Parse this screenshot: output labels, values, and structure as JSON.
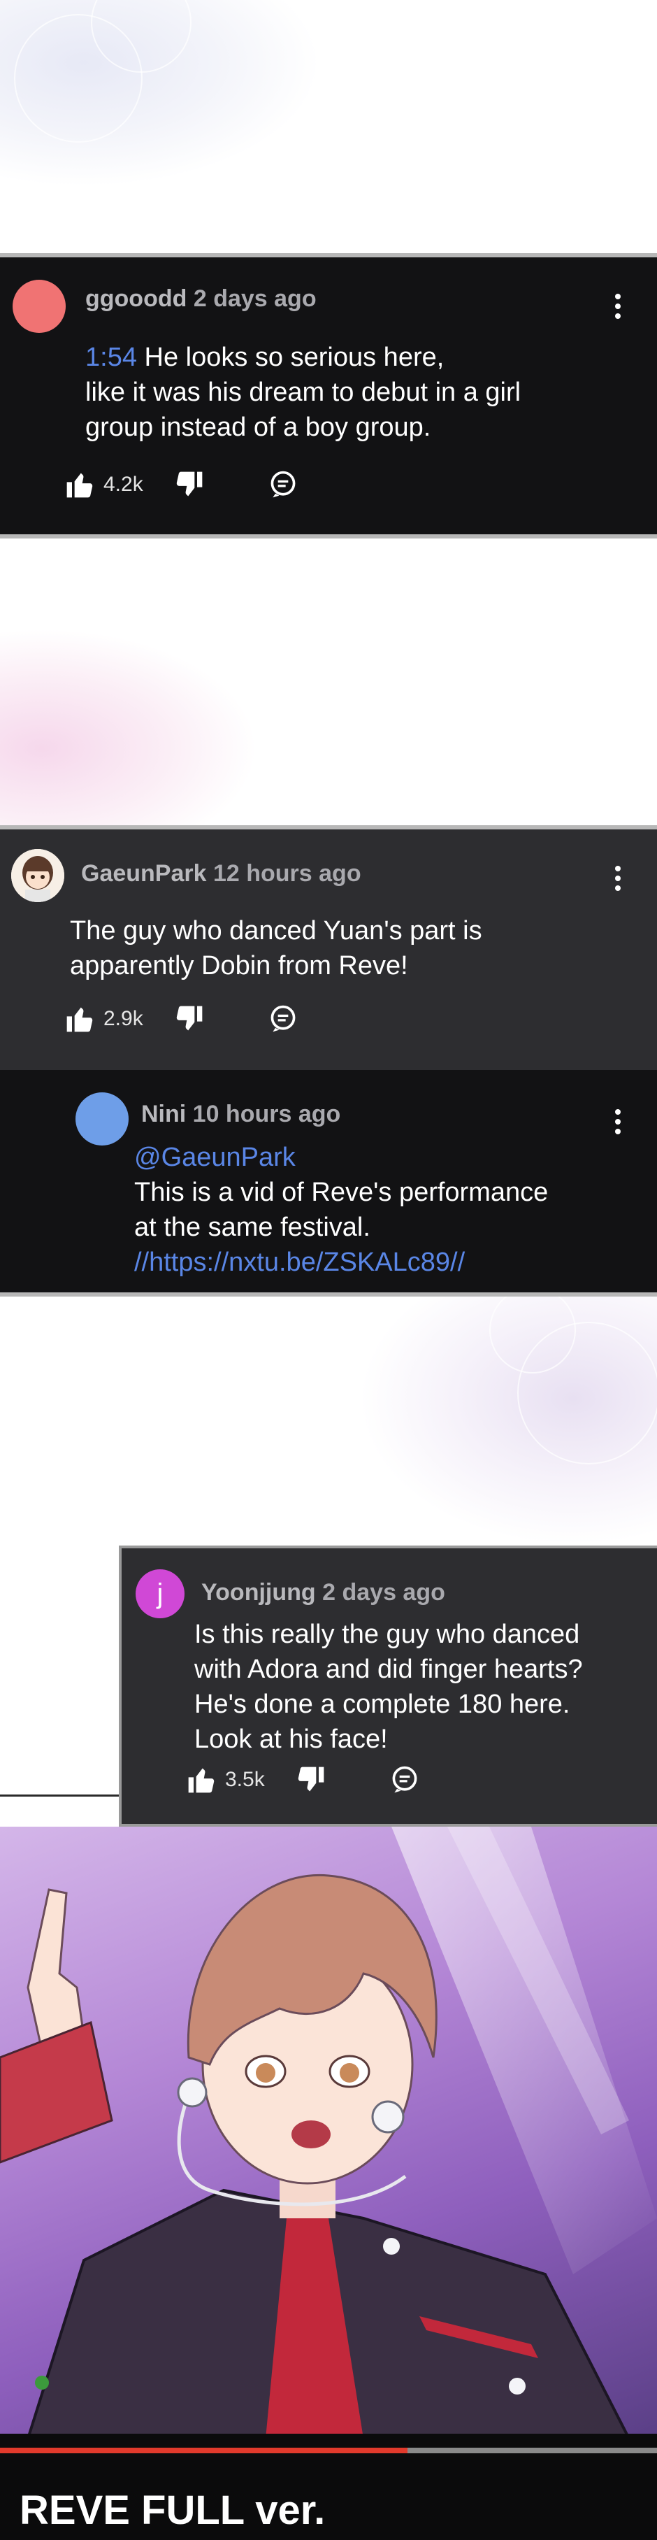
{
  "comments": [
    {
      "id": "c1",
      "username": "ggooodd",
      "time": "2 days ago",
      "avatar_color": "#f07373",
      "timestamp_link": "1:54",
      "text_lines": [
        "He looks so serious here,",
        "like it was his dream to debut in a girl",
        "group instead of a boy group."
      ],
      "likes": "4.2k"
    },
    {
      "id": "c2",
      "username": "GaeunPark",
      "time": "12 hours ago",
      "avatar_color": "#f3e6dc",
      "text_lines": [
        "The guy who danced Yuan's part is",
        "apparently Dobin from Reve!"
      ],
      "likes": "2.9k"
    },
    {
      "id": "c3",
      "username": "Nini",
      "time": "10 hours ago",
      "avatar_color": "#6e9ee8",
      "mention": "@GaeunPark",
      "text_lines": [
        "This is a vid of Reve's performance",
        "at the same festival."
      ],
      "url": "//https://nxtu.be/ZSKALc89//"
    },
    {
      "id": "c4",
      "username": "Yoonjjung",
      "time": "2 days ago",
      "avatar_color": "#d048d6",
      "avatar_letter": "j",
      "text_lines": [
        "Is this really the guy who danced",
        "with Adora and did finger hearts?",
        "He's done a complete 180 here.",
        "Look at his face!"
      ],
      "likes": "3.5k"
    }
  ],
  "video": {
    "title": "REVE FULL ver.",
    "progress": 0.62,
    "progress_color": "#e23a2c"
  },
  "icons": [
    "thumbs-up-icon",
    "thumbs-down-icon",
    "reply-icon",
    "more-options-icon"
  ]
}
